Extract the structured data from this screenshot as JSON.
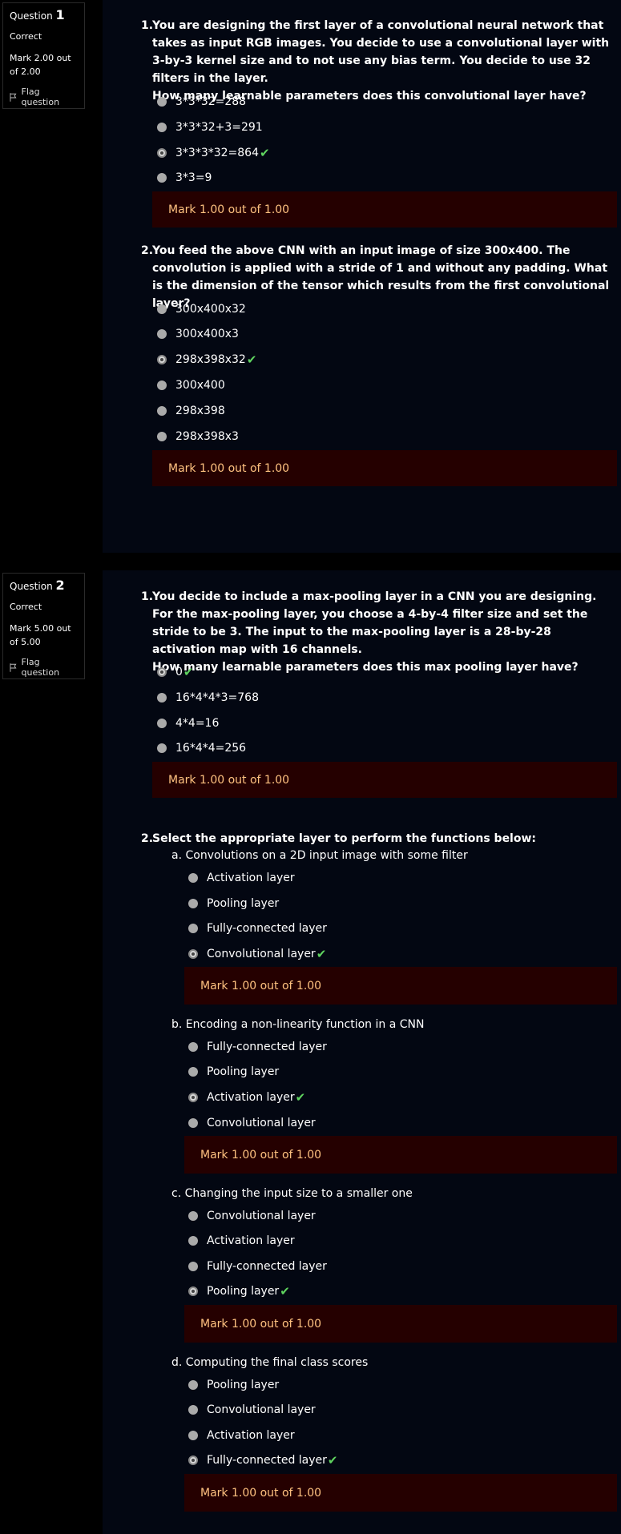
{
  "q1": {
    "label": "Question",
    "number": "1",
    "state": "Correct",
    "grade": "Mark 2.00 out of 2.00",
    "flag": "Flag question",
    "s1": {
      "num": "1.",
      "text": "You are designing the first layer of a convolutional neural network that takes as input RGB images. You decide to use a convolutional layer with 3-by-3 kernel size and to not use any bias term. You decide to use 32 filters in the layer.",
      "text2": "How many learnable parameters does this convolutional layer have?",
      "options": [
        "3*3*32=288",
        "3*3*32+3=291",
        "3*3*3*32=864",
        "3*3=9"
      ],
      "mark": "Mark 1.00 out of 1.00"
    },
    "s2": {
      "num": "2.",
      "text": "You feed the above CNN with an input image of size 300x400. The convolution is applied with a stride of 1 and without any padding. What is the dimension of the tensor which results from the first convolutional layer?",
      "options": [
        "300x400x32",
        "300x400x3",
        "298x398x32",
        "300x400",
        "298x398",
        "298x398x3"
      ],
      "mark": "Mark 1.00 out of 1.00"
    }
  },
  "q2": {
    "label": "Question",
    "number": "2",
    "state": "Correct",
    "grade": "Mark 5.00 out of 5.00",
    "flag": "Flag question",
    "s1": {
      "num": "1.",
      "text": "You decide to include a max-pooling layer in a CNN you are designing. For the max-pooling layer, you choose a 4-by-4 filter size and set the stride to be 3. The input to the max-pooling layer is a 28-by-28 activation map with 16 channels.",
      "text2": "How many learnable parameters does this max pooling layer have?",
      "options": [
        "0",
        "16*4*4*3=768",
        "4*4=16",
        "16*4*4=256"
      ],
      "mark": "Mark 1.00 out of 1.00"
    },
    "s2": {
      "num": "2.",
      "text": "Select the appropriate layer to perform the functions below:",
      "parts": [
        {
          "label": "a. Convolutions on a 2D input image with some filter",
          "options": [
            "Activation layer",
            "Pooling layer",
            "Fully-connected layer",
            "Convolutional layer"
          ],
          "mark": "Mark 1.00 out of 1.00"
        },
        {
          "label": "b. Encoding a non-linearity function in a CNN",
          "options": [
            "Fully-connected layer",
            "Pooling layer",
            "Activation layer",
            "Convolutional layer"
          ],
          "mark": "Mark 1.00 out of 1.00"
        },
        {
          "label": "c. Changing the input size to a smaller one",
          "options": [
            "Convolutional layer",
            "Activation layer",
            "Fully-connected layer",
            "Pooling layer"
          ],
          "mark": "Mark 1.00 out of 1.00"
        },
        {
          "label": "d. Computing the final class scores",
          "options": [
            "Pooling layer",
            "Convolutional layer",
            "Activation layer",
            "Fully-connected layer"
          ],
          "mark": "Mark 1.00 out of 1.00"
        }
      ]
    }
  },
  "check_color": "#5fd35f",
  "mark_bg": "#250000",
  "mark_text_color": "#ffc280"
}
